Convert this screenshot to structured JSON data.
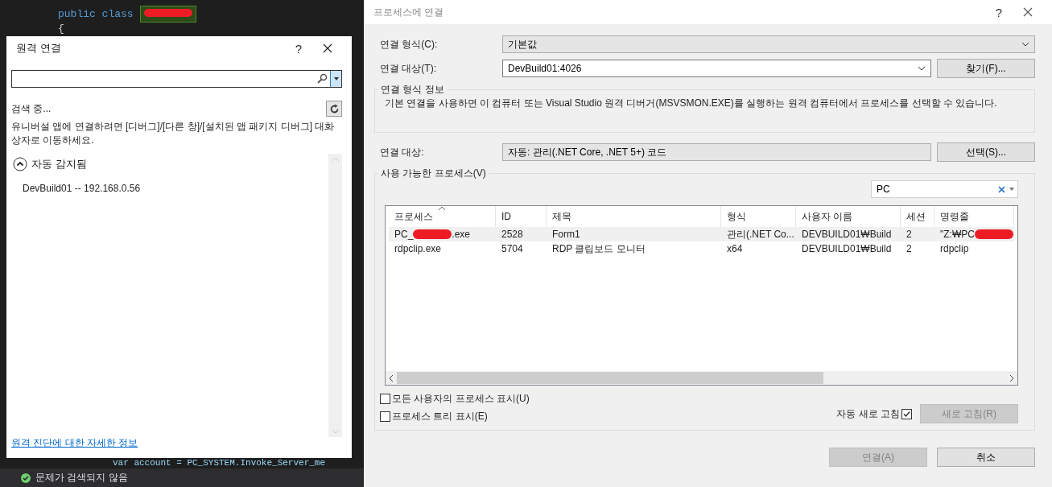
{
  "editor": {
    "code_keyword": "public class",
    "brace": "{",
    "bottom_line": "var account = PC_SYSTEM.Invoke_Server_me",
    "status": "문제가 검색되지 않음"
  },
  "remote_dialog": {
    "title": "원격 연결",
    "help": "?",
    "searching": "검색 중...",
    "hint": "유니버설 앱에 연결하려면 [디버그]/[다른 창]/[설치된 앱 패키지 디버그] 대화 상자로 이동하세요.",
    "section": {
      "label": "자동 감지됨",
      "expanded": true,
      "items": [
        "DevBuild01 -- 192.168.0.56"
      ]
    },
    "link": "원격 진단에 대한 자세한 정보"
  },
  "attach_dialog": {
    "title": "프로세스에 연결",
    "help": "?",
    "connection_type": {
      "label": "연결 형식(C):",
      "value": "기본값"
    },
    "connection_target": {
      "label": "연결 대상(T):",
      "value": "DevBuild01:4026",
      "button": "찾기(F)..."
    },
    "info": {
      "title": "연결 형식 정보",
      "text": "기본 연결을 사용하면 이 컴퓨터 또는 Visual Studio 원격 디버거(MSVSMON.EXE)를 실행하는 원격 컴퓨터에서 프로세스를 선택할 수 있습니다."
    },
    "attach_to": {
      "label": "연결 대상:",
      "value": "자동: 관리(.NET Core, .NET 5+) 코드",
      "button": "선택(S)..."
    },
    "processes": {
      "title": "사용 가능한 프로세스(V)",
      "filter": "PC",
      "columns": [
        {
          "label": "프로세스",
          "sorted": true
        },
        {
          "label": "ID",
          "sorted": false
        },
        {
          "label": "제목",
          "sorted": false
        },
        {
          "label": "형식",
          "sorted": false
        },
        {
          "label": "사용자 이름",
          "sorted": false
        },
        {
          "label": "세션",
          "sorted": false
        },
        {
          "label": "명령줄",
          "sorted": false
        }
      ],
      "rows": [
        {
          "selected": true,
          "cells": [
            {
              "text": "PC_",
              "redacted": true,
              "tail": ".exe"
            },
            {
              "text": "2528"
            },
            {
              "text": "Form1"
            },
            {
              "text": "관리(.NET Co..."
            },
            {
              "text": "DEVBUILD01₩Build"
            },
            {
              "text": "2"
            },
            {
              "text": "\"Z:₩PC",
              "redacted": true
            }
          ]
        },
        {
          "selected": false,
          "cells": [
            {
              "text": "rdpclip.exe"
            },
            {
              "text": "5704"
            },
            {
              "text": "RDP 클립보드 모니터"
            },
            {
              "text": "x64"
            },
            {
              "text": "DEVBUILD01₩Build"
            },
            {
              "text": "2"
            },
            {
              "text": "rdpclip"
            }
          ]
        }
      ],
      "options": [
        {
          "label": "모든 사용자의 프로세스 표시(U)",
          "checked": false
        },
        {
          "label": "프로세스 트리 표시(E)",
          "checked": false
        }
      ],
      "auto_refresh": {
        "label": "자동 새로 고침",
        "checked": true
      },
      "refresh_button": {
        "label": "새로 고침(R)",
        "disabled": true
      }
    },
    "buttons": [
      {
        "label": "연결(A)",
        "disabled": true
      },
      {
        "label": "취소",
        "disabled": false
      }
    ]
  }
}
